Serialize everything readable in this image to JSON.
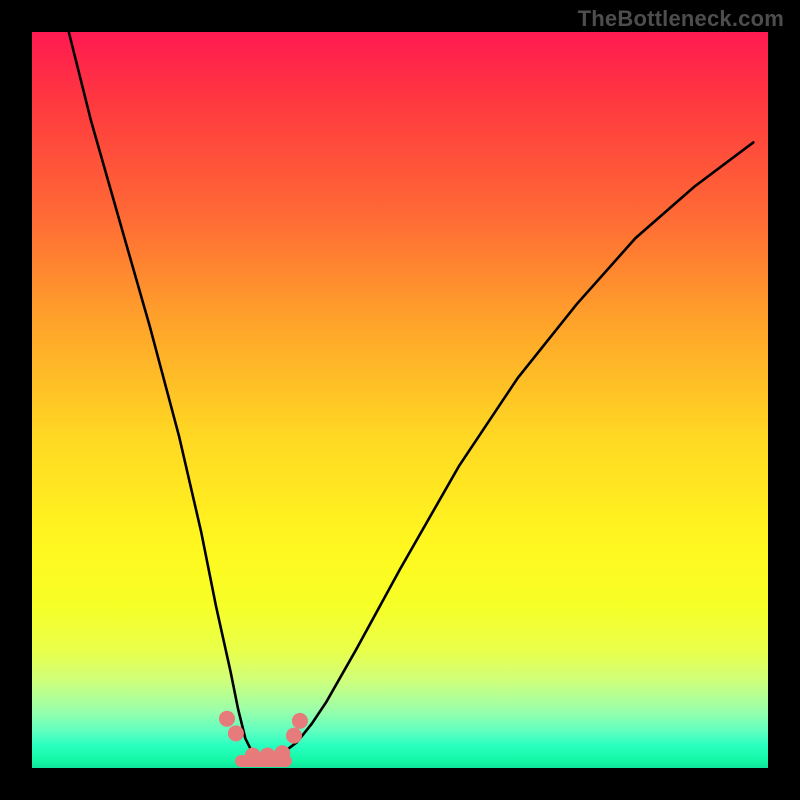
{
  "watermark": "TheBottleneck.com",
  "chart_data": {
    "type": "line",
    "title": "",
    "xlabel": "",
    "ylabel": "",
    "xlim": [
      0,
      100
    ],
    "ylim": [
      0,
      100
    ],
    "grid": false,
    "series": [
      {
        "name": "bottleneck-curve",
        "color": "#000000",
        "x": [
          5,
          8,
          12,
          16,
          20,
          23,
          25,
          27,
          28,
          29,
          30,
          31,
          32,
          34,
          36,
          38,
          40,
          44,
          50,
          58,
          66,
          74,
          82,
          90,
          98
        ],
        "y": [
          100,
          88,
          74,
          60,
          45,
          32,
          22,
          13,
          8,
          4,
          2,
          1.5,
          1.5,
          2,
          3.5,
          6,
          9,
          16,
          27,
          41,
          53,
          63,
          72,
          79,
          85
        ]
      }
    ],
    "markers": {
      "name": "hotspot-dots",
      "color": "#e77a7a",
      "radius_px": 8,
      "x": [
        26.5,
        27.7,
        30.0,
        32.0,
        34.0,
        35.6,
        36.4
      ],
      "y": [
        6.7,
        4.7,
        1.7,
        1.7,
        2.0,
        4.4,
        6.4
      ]
    },
    "bottom_bar": {
      "name": "floor-segment",
      "color": "#e77a7a",
      "x_start": 28.4,
      "x_end": 34.5,
      "thickness_px": 12
    }
  }
}
